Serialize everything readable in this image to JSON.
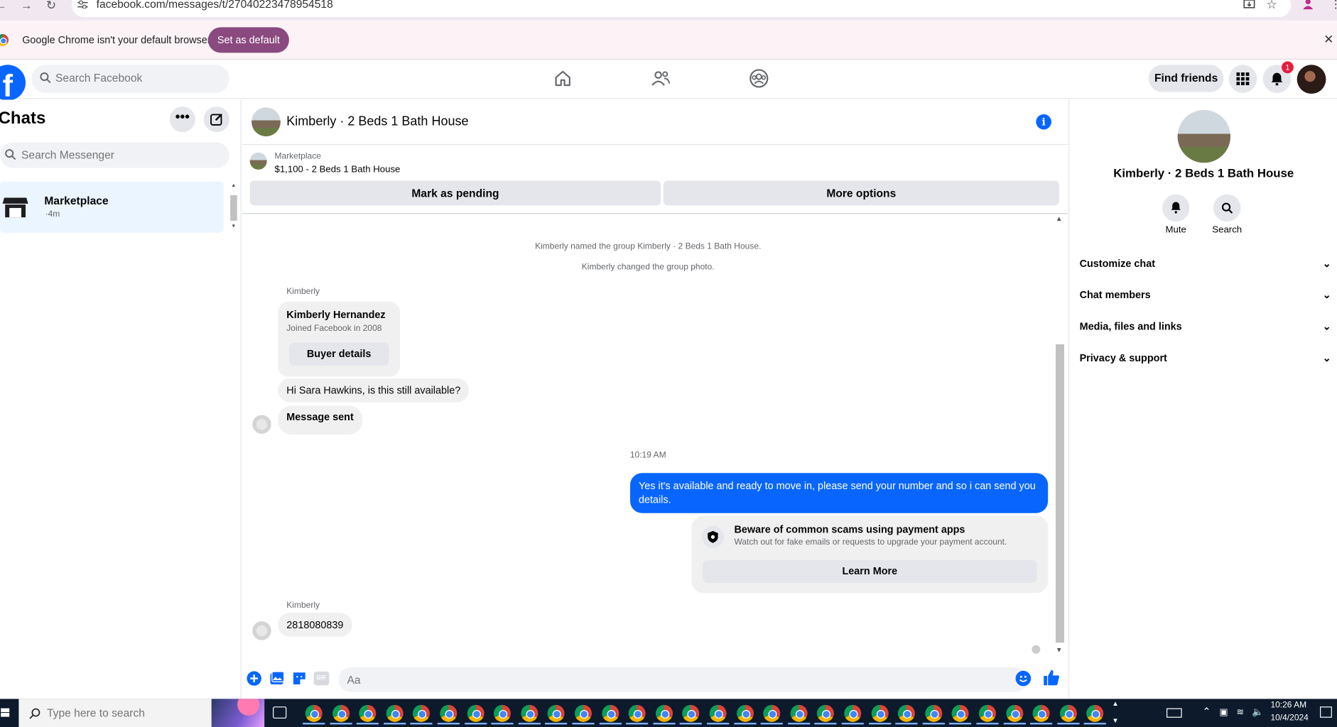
{
  "browser": {
    "url": "facebook.com/messages/t/27040223478954518",
    "infobar_text": "Google Chrome isn't your default browser",
    "set_default_label": "Set as default"
  },
  "header": {
    "search_placeholder": "Search Facebook",
    "find_friends_label": "Find friends",
    "notification_count": "1"
  },
  "chats": {
    "title": "Chats",
    "more_label": "•••",
    "search_placeholder": "Search Messenger",
    "items": [
      {
        "name": "Marketplace",
        "time": "·4m"
      }
    ]
  },
  "conversation": {
    "title": "Kimberly · 2 Beds 1 Bath House",
    "info_glyph": "i",
    "marketplace_label": "Marketplace",
    "listing": "$1,100 - 2 Beds 1 Bath House",
    "mark_pending_label": "Mark as pending",
    "more_options_label": "More options",
    "system_messages": [
      "Kimberly named the group Kimberly · 2 Beds 1 Bath House.",
      "Kimberly changed the group photo."
    ],
    "sender_label": "Kimberly",
    "buyer_card": {
      "name": "Kimberly Hernandez",
      "joined": "Joined Facebook in 2008",
      "button_label": "Buyer details"
    },
    "incoming_1": "Hi Sara Hawkins, is this still available?",
    "incoming_2": "Message sent",
    "time_separator": "10:19 AM",
    "outgoing_1": "Yes it's available and ready to move in, please send your number and so i can send you details.",
    "scam_card": {
      "title": "Beware of common scams using payment apps",
      "subtitle": "Watch out for fake emails or requests to upgrade your payment account.",
      "button_label": "Learn More"
    },
    "incoming_3": "2818080839",
    "composer_placeholder": "Aa",
    "gif_label": "GIF"
  },
  "info_panel": {
    "name": "Kimberly · 2 Beds 1 Bath House",
    "actions": [
      {
        "label": "Mute",
        "icon": "bell-icon"
      },
      {
        "label": "Search",
        "icon": "search-icon"
      }
    ],
    "sections": [
      "Customize chat",
      "Chat members",
      "Media, files and links",
      "Privacy & support"
    ],
    "chevron": "⌄"
  },
  "taskbar": {
    "search_placeholder": "Type here to search",
    "time": "10:26 AM",
    "date": "10/4/2024"
  },
  "colors": {
    "facebook_blue": "#0866ff",
    "selected_chat_bg": "#ebf5ff",
    "set_default_button": "#8a4a7f",
    "taskbar_bg": "#0c1a2c"
  }
}
